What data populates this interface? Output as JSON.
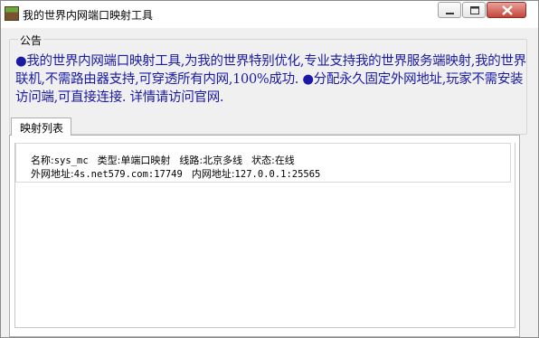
{
  "window": {
    "title": "我的世界内网端口映射工具",
    "icon": "minecraft-grass-block-icon"
  },
  "notice": {
    "legend": "公告",
    "text": "●我的世界内网端口映射工具,为我的世界特别优化,专业支持我的世界服务端映射,我的世界联机,不需路由器支持,可穿透所有内网,100%成功. ●分配永久固定外网地址,玩家不需安装访问端,可直接连接. 详情请访问官网.",
    "text_color": "#1a1aa6"
  },
  "tabs": [
    {
      "label": "映射列表",
      "selected": true
    }
  ],
  "mappings": [
    {
      "name_label": "名称:",
      "name": "sys_mc",
      "type_label": "类型:",
      "type": "单端口映射",
      "route_label": "线路:",
      "route": "北京多线",
      "status_label": "状态:",
      "status": "在线",
      "external_label": "外网地址:",
      "external": "4s.net579.com:17749",
      "internal_label": "内网地址:",
      "internal": "127.0.0.1:25565"
    }
  ]
}
